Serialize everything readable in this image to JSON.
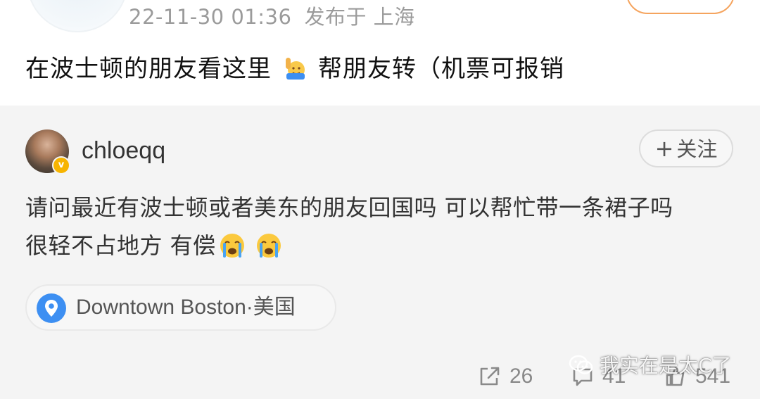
{
  "post": {
    "timestamp": "22-11-30 01:36",
    "location_label": "发布于 上海",
    "text_main": "在波士顿的朋友看这里",
    "text_emoji_icon": "hand-raise-emoji-icon",
    "text_tail": "帮朋友转（机票可报销"
  },
  "comment": {
    "username": "chloeqq",
    "follow_plus": "+",
    "follow_label": "关注",
    "line1": "请问最近有波士顿或者美东的朋友回国吗 可以帮忙带一条裙子吗",
    "line2": "很轻不占地方 有偿",
    "emoji_icons": [
      "crying-face-icon",
      "crying-face-icon"
    ],
    "location_tag": "Downtown Boston·美国",
    "actions": {
      "share_count": "26",
      "comment_count": "41",
      "like_count": "541"
    }
  },
  "watermark": {
    "text": "我实在是太C了"
  },
  "colors": {
    "card_bg": "#f4f4f4",
    "pin_blue": "#3d8ff2",
    "follow_orange": "#f5a45e",
    "meta_gray": "#9b9b9b"
  }
}
